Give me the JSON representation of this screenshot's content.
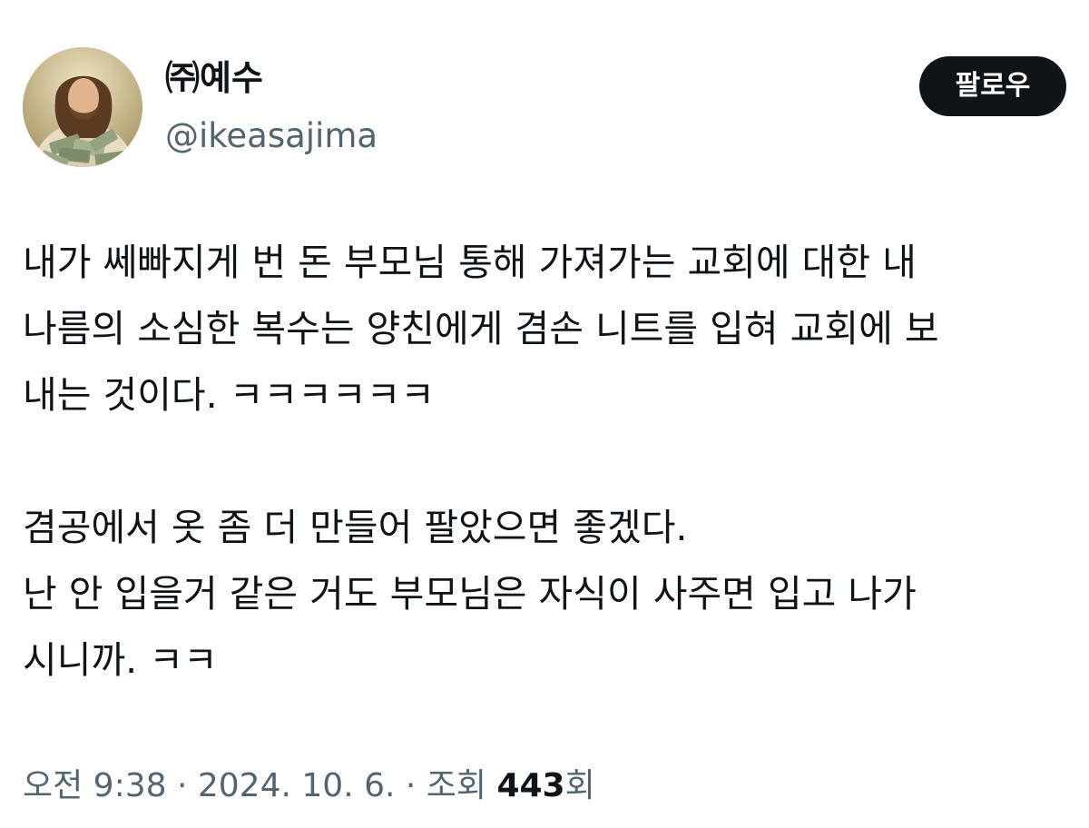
{
  "author": {
    "display_name": "㈜예수",
    "handle": "@ikeasajima",
    "avatar": "jesus-painting-holding-money-avatar"
  },
  "follow_button": {
    "label": "팔로우"
  },
  "tweet": {
    "paragraph1": [
      "내가 쎄빠지게 번 돈 부모님 통해 가져가는 교회에 대한 내",
      "나름의 소심한 복수는 양친에게 겸손 니트를 입혀 교회에 보",
      "내는 것이다. ㅋㅋㅋㅋㅋㅋ"
    ],
    "paragraph2": [
      "겸공에서 옷 좀 더 만들어 팔았으면 좋겠다.",
      "난 안 입을거 같은 거도 부모님은 자식이 사주면 입고 나가",
      "시니까. ㅋㅋ"
    ]
  },
  "meta": {
    "time": "오전 9:38",
    "separator": " · ",
    "date": "2024. 10. 6.",
    "views_label": "조회 ",
    "views_count": "443",
    "views_suffix": "회"
  },
  "colors": {
    "primary_text": "#0f1419",
    "secondary_text": "#536471",
    "button_bg": "#0f1419",
    "button_text": "#ffffff"
  }
}
